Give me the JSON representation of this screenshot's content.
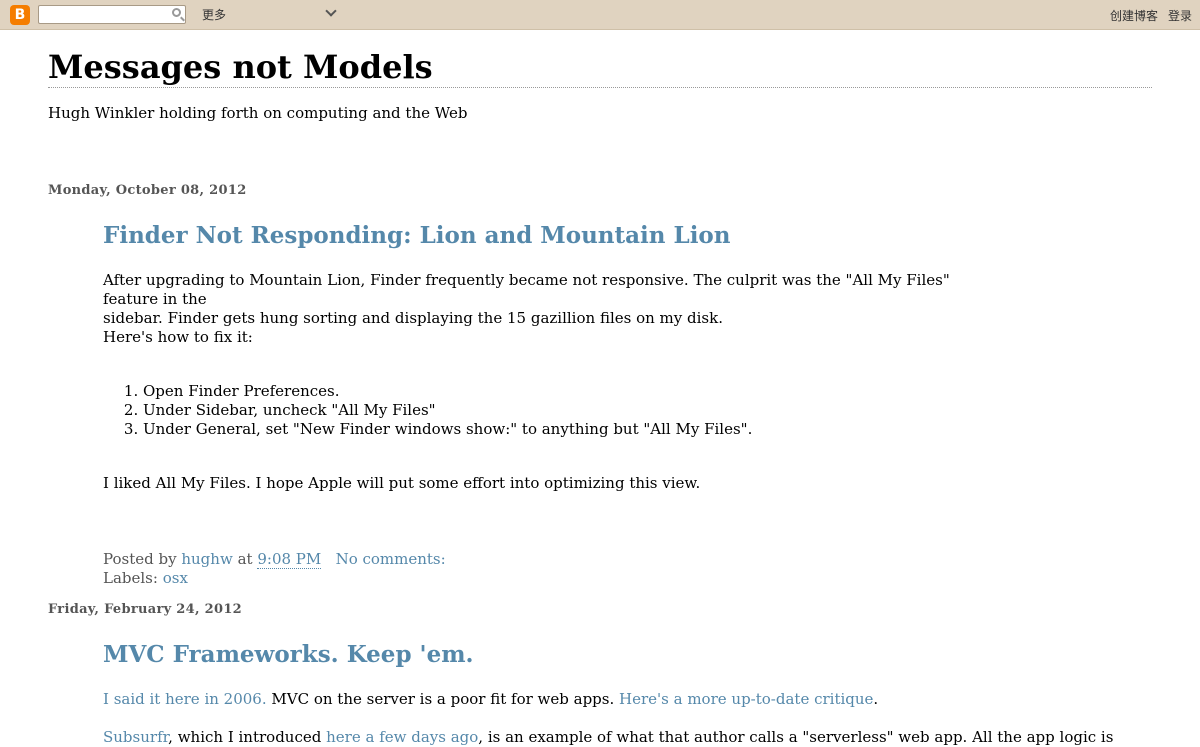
{
  "navbar": {
    "logo_letter": "B",
    "search_placeholder": "",
    "more_label": "更多",
    "create_blog": "创建博客",
    "sign_in": "登录"
  },
  "blog": {
    "title": "Messages not Models",
    "description": "Hugh Winkler holding forth on computing and the Web"
  },
  "posts": [
    {
      "date": "Monday, October 08, 2012",
      "title": "Finder Not Responding: Lion and Mountain Lion",
      "para1_line1": "After upgrading to Mountain Lion, Finder frequently became not responsive. The culprit was the \"All My Files\" feature in the",
      "para1_line2": "sidebar. Finder gets hung sorting and displaying the 15 gazillion files on my disk.",
      "para2": "Here's how to fix it:",
      "steps": [
        "Open Finder Preferences.",
        "Under Sidebar, uncheck \"All My Files\"",
        "Under General, set \"New Finder windows show:\" to anything but \"All My Files\"."
      ],
      "para3": "I liked All My Files. I hope Apple will put some effort into optimizing this view.",
      "posted_by_label": "Posted by",
      "author": "hughw",
      "at_label": "at",
      "time": "9:08 PM",
      "comments": "No comments:",
      "labels_label": "Labels:",
      "label": "osx"
    },
    {
      "date": "Friday, February 24, 2012",
      "title": "MVC Frameworks. Keep 'em.",
      "link1": "I said it here in 2006.",
      "text1": " MVC on the server is a poor fit for web apps. ",
      "link2": "Here's a more up-to-date critique",
      "text2": ".",
      "link3": "Subsurfr",
      "text3": ", which I introduced ",
      "link4": "here a few days ago",
      "text4": ", is an example of what that author calls a \"serverless\" web app. All the app logic is"
    }
  ]
}
